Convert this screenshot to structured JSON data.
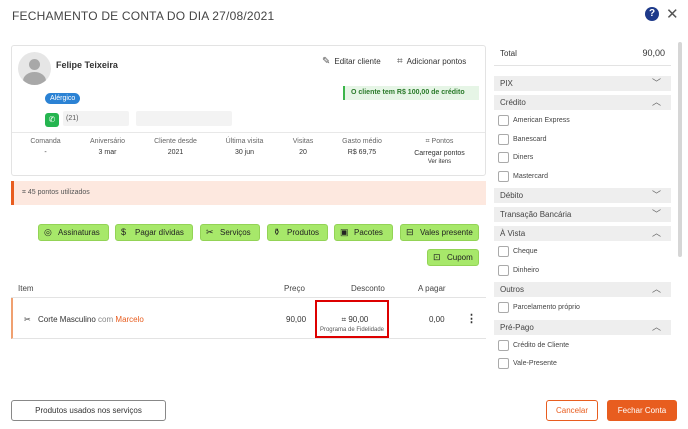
{
  "header": {
    "title": "FECHAMENTO DE CONTA DO DIA 27/08/2021"
  },
  "client": {
    "name": "Felipe Teixeira",
    "edit_label": "Editar cliente",
    "add_points_label": "Adicionar pontos",
    "tag": "Alérgico",
    "credit_text": "O cliente tem R$ 100,00 de crédito",
    "phone": "(21)"
  },
  "stats": {
    "comanda_label": "Comanda",
    "comanda_value": "-",
    "aniversario_label": "Aniversário",
    "aniversario_value": "3 mar",
    "cliente_desde_label": "Cliente desde",
    "cliente_desde_value": "2021",
    "ultima_visita_label": "Última visita",
    "ultima_visita_value": "30 jun",
    "visitas_label": "Visitas",
    "visitas_value": "20",
    "gasto_label": "Gasto médio",
    "gasto_value": "R$ 69,75",
    "pontos_label": "Pontos",
    "pontos_value": "Carregar pontos",
    "pontos_sub": "Ver itens"
  },
  "points_banner": "45 pontos utilizados",
  "actions": {
    "assinaturas": "Assinaturas",
    "pagar_dividas": "Pagar dívidas",
    "servicos": "Serviços",
    "produtos": "Produtos",
    "pacotes": "Pacotes",
    "vales": "Vales presente",
    "cupom": "Cupom"
  },
  "table": {
    "headers": {
      "item": "Item",
      "preco": "Preço",
      "desconto": "Desconto",
      "apagar": "A pagar"
    },
    "row": {
      "item": "Corte Masculino",
      "com": "com",
      "staff": "Marcelo",
      "preco": "90,00",
      "desconto": "90,00",
      "desconto_sub": "Programa de Fidelidade",
      "apagar": "0,00"
    }
  },
  "footer": {
    "produtos_label": "Produtos usados nos serviços",
    "cancel_label": "Cancelar",
    "close_label": "Fechar Conta"
  },
  "payment": {
    "total_label": "Total",
    "total_value": "90,00",
    "groups": [
      {
        "label": "PIX",
        "expanded": false
      },
      {
        "label": "Crédito",
        "expanded": true,
        "options": [
          "American Express",
          "Banescard",
          "Diners",
          "Mastercard"
        ]
      },
      {
        "label": "Débito",
        "expanded": false
      },
      {
        "label": "Transação Bancária",
        "expanded": false
      },
      {
        "label": "À Vista",
        "expanded": true,
        "options": [
          "Cheque",
          "Dinheiro"
        ]
      },
      {
        "label": "Outros",
        "expanded": true,
        "options": [
          "Parcelamento próprio"
        ]
      },
      {
        "label": "Pré-Pago",
        "expanded": true,
        "options": [
          "Crédito de Cliente",
          "Vale-Presente"
        ]
      }
    ]
  },
  "colors": {
    "accent": "#e85d1f",
    "action_green": "#a7e86a",
    "tag_blue": "#2b82d4",
    "alert_border": "#d00"
  }
}
